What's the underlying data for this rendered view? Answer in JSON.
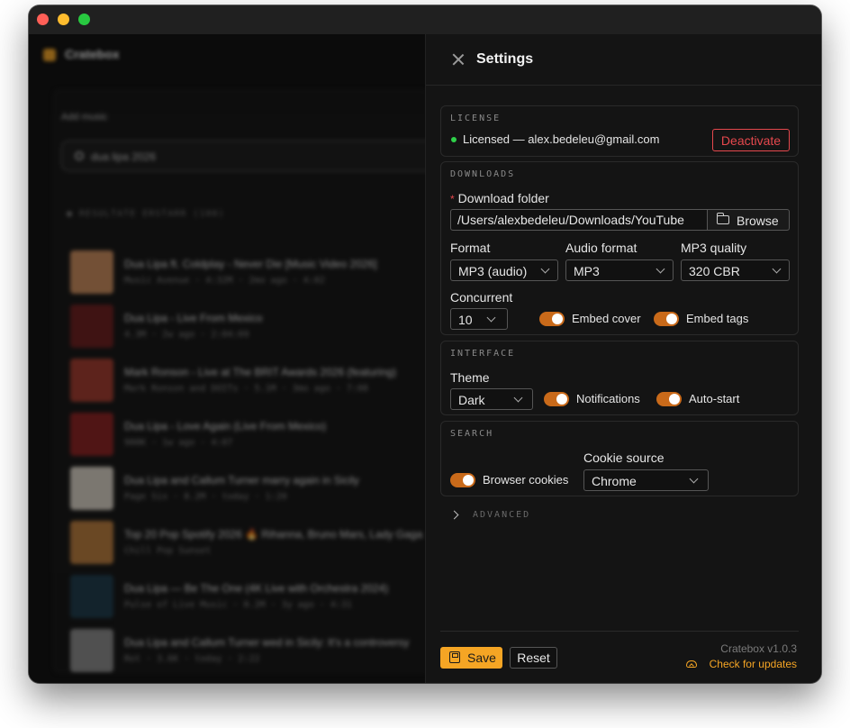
{
  "background_app": {
    "brand": "Cratebox",
    "add_music_label": "Add music",
    "search_value": "dua lipa 2026",
    "results_heading": "● RESULTATE ERSTARR (100)",
    "results": [
      {
        "title": "Dua Lipa ft. Coldplay - Never Die [Music Video 2026]",
        "meta": "Music Avenue · 4:32M · 2mo ago · 4:02",
        "color": "#c98a5a"
      },
      {
        "title": "Dua Lipa - Live From Mexico",
        "meta": "4.3M · 2w ago · 2:04:09",
        "color": "#6a1a1a"
      },
      {
        "title": "Mark Ronson - Live at The BRIT Awards 2026 (featuring)",
        "meta": "Mark Ronson and DOITs · 5.1M · 3mo ago · 7:08",
        "color": "#a0382a"
      },
      {
        "title": "Dua Lipa - Love Again (Live From Mexico)",
        "meta": "900K · 1w ago · 4:07",
        "color": "#8a1e1e"
      },
      {
        "title": "Dua Lipa and Callum Turner marry again in Sicily",
        "meta": "Page Six · 8.2M · today · 1:20",
        "color": "#d8d0c4"
      },
      {
        "title": "Top 20 Pop Spotify 2026 🔥 Rihanna, Bruno Mars, Lady Gaga",
        "meta": "Chill Pop Sunset",
        "color": "#b87a3a"
      },
      {
        "title": "Dua Lipa — Be The One (4K Live with Orchestra 2024)",
        "meta": "Pulse of Live Music · 0.2M · 3y ago · 4:31",
        "color": "#1c3a4a"
      },
      {
        "title": "Dua Lipa and Callum Turner wed in Sicily: It's a controversy",
        "meta": "Rot · 3.6K · today · 2:22",
        "color": "#8a8a8a"
      }
    ]
  },
  "settings": {
    "title": "Settings",
    "license": {
      "section_label": "LICENSE",
      "status": "Licensed — alex.bedeleu@gmail.com",
      "deactivate_label": "Deactivate"
    },
    "downloads": {
      "section_label": "DOWNLOADS",
      "folder_label": "Download folder",
      "required_mark": "*",
      "folder_value": "/Users/alexbedeleu/Downloads/YouTube",
      "browse_label": "Browse",
      "format_label": "Format",
      "format_value": "MP3 (audio)",
      "audio_format_label": "Audio format",
      "audio_format_value": "MP3",
      "mp3_quality_label": "MP3 quality",
      "mp3_quality_value": "320 CBR",
      "concurrent_label": "Concurrent",
      "concurrent_value": "10",
      "embed_cover_label": "Embed cover",
      "embed_tags_label": "Embed tags"
    },
    "interface": {
      "section_label": "INTERFACE",
      "theme_label": "Theme",
      "theme_value": "Dark",
      "notifications_label": "Notifications",
      "autostart_label": "Auto-start"
    },
    "search": {
      "section_label": "SEARCH",
      "browser_cookies_label": "Browser cookies",
      "cookie_source_label": "Cookie source",
      "cookie_source_value": "Chrome"
    },
    "advanced_label": "ADVANCED",
    "footer": {
      "save_label": "Save",
      "reset_label": "Reset",
      "version": "Cratebox v1.0.3",
      "check_updates_label": "Check for updates"
    }
  },
  "colors": {
    "accent": "#f5a524",
    "toggle_on": "#c96a1a",
    "danger": "#e5484d",
    "success": "#2fd14a"
  }
}
